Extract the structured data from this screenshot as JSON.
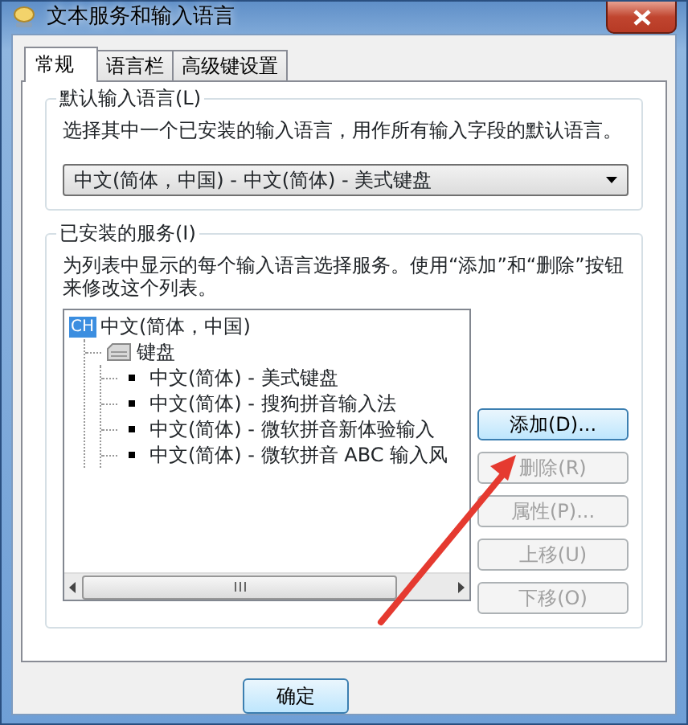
{
  "window": {
    "title": "文本服务和输入语言"
  },
  "tabs": [
    {
      "label": "常规",
      "selected": true
    },
    {
      "label": "语言栏",
      "selected": false
    },
    {
      "label": "高级键设置",
      "selected": false
    }
  ],
  "default_language": {
    "legend": "默认输入语言(L)",
    "description": "选择其中一个已安装的输入语言，用作所有输入字段的默认语言。",
    "dropdown": {
      "value": "中文(简体，中国) - 中文(简体) - 美式键盘"
    }
  },
  "installed_services": {
    "legend": "已安装的服务(I)",
    "description": "为列表中显示的每个输入语言选择服务。使用“添加”和“删除”按钮来修改这个列表。",
    "tree": [
      {
        "kind": "language",
        "badge": "CH",
        "label": "中文(简体，中国)",
        "children": [
          {
            "kind": "category",
            "label": "键盘",
            "children": [
              {
                "kind": "service",
                "label": "中文(简体) - 美式键盘"
              },
              {
                "kind": "service",
                "label": "中文(简体) - 搜狗拼音输入法"
              },
              {
                "kind": "service",
                "label": "中文(简体) - 微软拼音新体验输入"
              },
              {
                "kind": "service",
                "label": "中文(简体) - 微软拼音 ABC 输入风"
              }
            ]
          }
        ]
      }
    ],
    "buttons": [
      {
        "label": "添加(D)...",
        "disabled": false,
        "focused": true
      },
      {
        "label": "删除(R)",
        "disabled": true,
        "focused": false
      },
      {
        "label": "属性(P)...",
        "disabled": true,
        "focused": false
      },
      {
        "label": "上移(U)",
        "disabled": true,
        "focused": false
      },
      {
        "label": "下移(O)",
        "disabled": true,
        "focused": false
      }
    ]
  },
  "footer_buttons": [
    {
      "label": "确定",
      "disabled": false
    }
  ]
}
